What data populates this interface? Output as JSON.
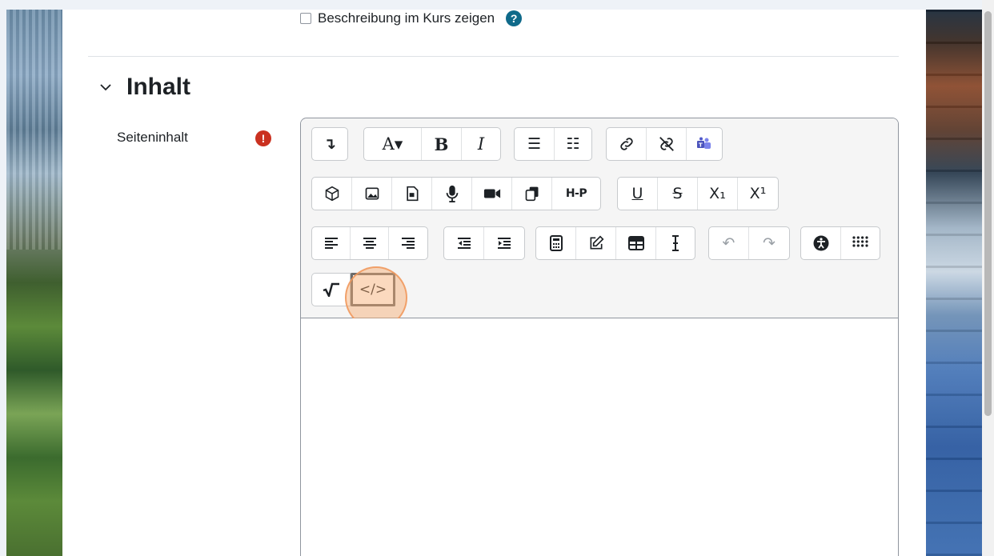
{
  "settings": {
    "show_description_label": "Beschreibung im Kurs zeigen",
    "help_icon_glyph": "?"
  },
  "section": {
    "title": "Inhalt"
  },
  "field": {
    "label": "Seiteninhalt",
    "required_glyph": "!"
  },
  "toolbar": {
    "row1": {
      "collapse": "↴",
      "font_style": "A▾",
      "bold": "B",
      "italic": "I",
      "bullet_list": "☰",
      "numbered_list": "☷",
      "link": "🔗",
      "unlink": "⛓",
      "teams": "teams"
    },
    "row2": {
      "h5p": "H-P",
      "underline": "U",
      "strikethrough": "S",
      "subscript": "X₁",
      "superscript": "X¹"
    },
    "row3": {
      "align_left": "≡",
      "align_center": "≡",
      "align_right": "≡",
      "outdent": "⇤",
      "indent": "⇥",
      "undo": "↶",
      "redo": "↷"
    },
    "row4": {
      "equation": "√‾",
      "html_source": "</>"
    }
  },
  "colors": {
    "help_icon": "#0f6a8a",
    "required_icon": "#ca3120",
    "highlight": "#f6aa6e"
  }
}
